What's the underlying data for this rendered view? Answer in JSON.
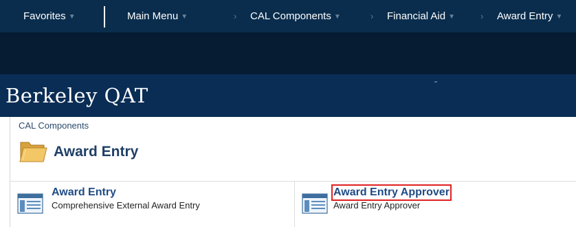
{
  "nav": {
    "favorites": "Favorites",
    "main_menu": "Main Menu",
    "cal_components": "CAL Components",
    "financial_aid": "Financial Aid",
    "award_entry": "Award Entry",
    "caret": "▼",
    "separator": "›"
  },
  "banner": {
    "title": "Berkeley QAT"
  },
  "breadcrumb": "CAL Components",
  "page_title": "Award Entry",
  "tiles": [
    {
      "link": "Award Entry",
      "description": "Comprehensive External Award Entry"
    },
    {
      "link": "Award Entry Approver",
      "description": "Award Entry Approver"
    }
  ]
}
